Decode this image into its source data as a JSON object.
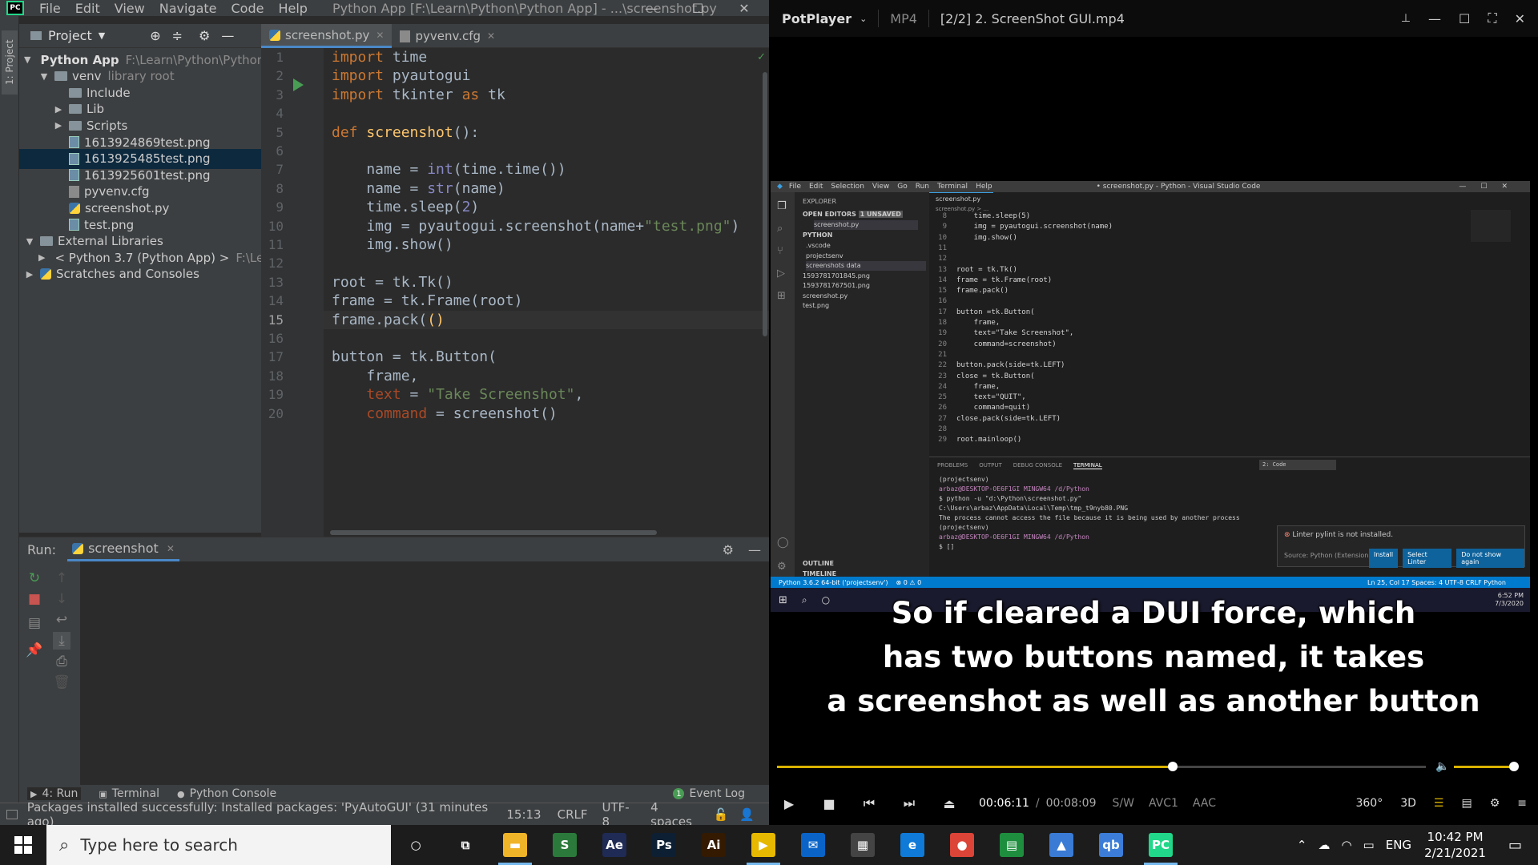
{
  "pycharm": {
    "menu": [
      "File",
      "Edit",
      "View",
      "Navigate",
      "Code",
      "Help"
    ],
    "title": "Python App [F:\\Learn\\Python\\Python App] - ...\\screenshot.py",
    "project_header": "Project",
    "left_tab": "1: Project",
    "tree": [
      {
        "label": "Python App",
        "hint": "F:\\Learn\\Python\\Python A",
        "indent": 0,
        "kind": "folder",
        "tw": "▼",
        "bold": true
      },
      {
        "label": "venv",
        "hint": "library root",
        "indent": 1,
        "kind": "folder",
        "tw": "▼"
      },
      {
        "label": "Include",
        "hint": "",
        "indent": 2,
        "kind": "folder",
        "tw": ""
      },
      {
        "label": "Lib",
        "hint": "",
        "indent": 2,
        "kind": "folder",
        "tw": "▶"
      },
      {
        "label": "Scripts",
        "hint": "",
        "indent": 2,
        "kind": "folder",
        "tw": "▶"
      },
      {
        "label": "1613924869test.png",
        "hint": "",
        "indent": 2,
        "kind": "png",
        "tw": ""
      },
      {
        "label": "1613925485test.png",
        "hint": "",
        "indent": 2,
        "kind": "png",
        "tw": "",
        "selected": true
      },
      {
        "label": "1613925601test.png",
        "hint": "",
        "indent": 2,
        "kind": "png",
        "tw": ""
      },
      {
        "label": "pyvenv.cfg",
        "hint": "",
        "indent": 2,
        "kind": "cfg",
        "tw": ""
      },
      {
        "label": "screenshot.py",
        "hint": "",
        "indent": 2,
        "kind": "py",
        "tw": ""
      },
      {
        "label": "test.png",
        "hint": "",
        "indent": 2,
        "kind": "png",
        "tw": ""
      },
      {
        "label": "External Libraries",
        "hint": "",
        "indent": 0,
        "kind": "lib",
        "tw": "▼"
      },
      {
        "label": "< Python 3.7 (Python App) >",
        "hint": "F:\\Le",
        "indent": 1,
        "kind": "py",
        "tw": "▶"
      },
      {
        "label": "Scratches and Consoles",
        "hint": "",
        "indent": 0,
        "kind": "scratch",
        "tw": "▶"
      }
    ],
    "tabs": [
      {
        "label": "screenshot.py",
        "active": true
      },
      {
        "label": "pyvenv.cfg",
        "active": false
      }
    ],
    "line_numbers": [
      "1",
      "2",
      "3",
      "4",
      "5",
      "6",
      "7",
      "8",
      "9",
      "10",
      "11",
      "12",
      "13",
      "14",
      "15",
      "16",
      "17",
      "18",
      "19",
      "20"
    ],
    "current_line": 15,
    "code": [
      [
        [
          "kw",
          "import"
        ],
        [
          "t",
          " time"
        ]
      ],
      [
        [
          "kw",
          "import"
        ],
        [
          "t",
          " pyautogui"
        ]
      ],
      [
        [
          "kw",
          "import"
        ],
        [
          "t",
          " tkinter "
        ],
        [
          "kw",
          "as"
        ],
        [
          "t",
          " tk"
        ]
      ],
      [],
      [
        [
          "kw",
          "def"
        ],
        [
          "t",
          " "
        ],
        [
          "fn",
          "screenshot"
        ],
        [
          "t",
          "():"
        ]
      ],
      [],
      [
        [
          "t",
          "    name = "
        ],
        [
          "bi",
          "int"
        ],
        [
          "t",
          "(time.time())"
        ]
      ],
      [
        [
          "t",
          "    name = "
        ],
        [
          "bi",
          "str"
        ],
        [
          "t",
          "(name)"
        ]
      ],
      [
        [
          "t",
          "    time.sleep("
        ],
        [
          "bi",
          "2"
        ],
        [
          "t",
          ")"
        ]
      ],
      [
        [
          "t",
          "    img = pyautogui.screenshot(name+"
        ],
        [
          "st",
          "\"test.png\""
        ],
        [
          "t",
          ")"
        ]
      ],
      [
        [
          "t",
          "    img.show()"
        ]
      ],
      [],
      [
        [
          "t",
          "root = tk.Tk()"
        ]
      ],
      [
        [
          "t",
          "frame = tk.Frame(root)"
        ]
      ],
      [
        [
          "t",
          "frame.pack("
        ],
        [
          "fn",
          "()"
        ]
      ],
      [],
      [
        [
          "t",
          "button = tk.Button("
        ]
      ],
      [
        [
          "t",
          "    frame,"
        ]
      ],
      [
        [
          "t",
          "    "
        ],
        [
          "pm",
          "text"
        ],
        [
          "t",
          " = "
        ],
        [
          "st",
          "\"Take Screenshot\""
        ],
        [
          "t",
          ","
        ]
      ],
      [
        [
          "t",
          "    "
        ],
        [
          "pm",
          "command"
        ],
        [
          "t",
          " = screenshot()"
        ]
      ]
    ],
    "run_label": "Run:",
    "run_tab": "screenshot",
    "bottom_tabs": [
      "4: Run",
      "Terminal",
      "Python Console"
    ],
    "event_log": "Event Log",
    "status_msg": "Packages installed successfully: Installed packages: 'PyAutoGUI' (31 minutes ago)",
    "status_pos": "15:13",
    "status_eol": "CRLF",
    "status_enc": "UTF-8",
    "status_indent": "4 spaces"
  },
  "potplayer": {
    "brand": "PotPlayer",
    "format": "MP4",
    "file": "[2/2] 2. ScreenShot GUI.mp4",
    "subtitle_lines": [
      "So if cleared a DUI force, which",
      "has two buttons named, it takes",
      "a screenshot as well as another button"
    ],
    "time_current": "00:06:11",
    "time_total": "00:08:09",
    "badges": [
      "S/W",
      "AVC1",
      "AAC"
    ],
    "progress_fraction": 0.61,
    "video": {
      "title": "• screenshot.py - Python - Visual Studio Code",
      "menu": [
        "File",
        "Edit",
        "Selection",
        "View",
        "Go",
        "Run",
        "Terminal",
        "Help"
      ],
      "explorer": "EXPLORER",
      "open_editors": "OPEN EDITORS",
      "unsaved": "1 UNSAVED",
      "open_file": "screenshot.py",
      "python_folder": "PYTHON",
      "files": [
        ".vscode",
        "projectsenv",
        "screenshots data",
        "1593781701845.png",
        "1593781767501.png",
        "screenshot.py",
        "test.png"
      ],
      "outline": "OUTLINE",
      "timeline": "TIMELINE",
      "tab": "screenshot.py",
      "breadcrumb": "screenshot.py > ...",
      "code_numbers": [
        "8",
        "9",
        "10",
        "11",
        "12",
        "13",
        "14",
        "15",
        "16",
        "17",
        "18",
        "19",
        "20",
        "21",
        "22",
        "23",
        "24",
        "25",
        "26",
        "27",
        "28",
        "29"
      ],
      "code_lines": [
        "    time.sleep(5)",
        "    img = pyautogui.screenshot(name)",
        "    img.show()",
        "",
        "",
        "root = tk.Tk()",
        "frame = tk.Frame(root)",
        "frame.pack()",
        "",
        "button =tk.Button(",
        "    frame,",
        "    text=\"Take Screenshot\",",
        "    command=screenshot)",
        "",
        "button.pack(side=tk.LEFT)",
        "close = tk.Button(",
        "    frame,",
        "    text=\"QUIT\",",
        "    command=quit)",
        "close.pack(side=tk.LEFT)",
        "",
        "root.mainloop()"
      ],
      "term_tabs": [
        "PROBLEMS",
        "OUTPUT",
        "DEBUG CONSOLE",
        "TERMINAL"
      ],
      "term_select": "2: Code",
      "term_lines": [
        "(projectsenv)",
        "arbaz@DESKTOP-OE6F1GI MINGW64 /d/Python",
        "$ python -u \"d:\\Python\\screenshot.py\"",
        "C:\\Users\\arbaz\\AppData\\Local\\Temp\\tmp_t9nyb80.PNG",
        "The process cannot access the file because it is being used by another process",
        "(projectsenv)",
        "arbaz@DESKTOP-OE6F1GI MINGW64 /d/Python",
        "$ []"
      ],
      "toast_msg": "Linter pylint is not installed.",
      "toast_source": "Source: Python (Extension)",
      "toast_buttons": [
        "Install",
        "Select Linter",
        "Do not show again"
      ],
      "status_left": "Python 3.6.2 64-bit ('projectsenv')",
      "status_err": "⊗ 0 ⚠ 0",
      "status_right": "Ln 25, Col 17   Spaces: 4   UTF-8   CRLF   Python",
      "tray_time": "6:52 PM",
      "tray_date": "7/3/2020"
    }
  },
  "taskbar": {
    "search_placeholder": "Type here to search",
    "apps": [
      {
        "name": "cortana",
        "label": "○",
        "bg": "transparent"
      },
      {
        "name": "task-view",
        "label": "⧉",
        "bg": "transparent"
      },
      {
        "name": "file-explorer",
        "label": "▬",
        "bg": "#f0b429"
      },
      {
        "name": "sublime",
        "label": "S",
        "bg": "#2b7a3b"
      },
      {
        "name": "after-effects",
        "label": "Ae",
        "bg": "#1f2a55"
      },
      {
        "name": "photoshop",
        "label": "Ps",
        "bg": "#0d1f33"
      },
      {
        "name": "illustrator",
        "label": "Ai",
        "bg": "#331a00"
      },
      {
        "name": "potplayer",
        "label": "▶",
        "bg": "#e6b800"
      },
      {
        "name": "mail",
        "label": "✉",
        "bg": "#0a64c8"
      },
      {
        "name": "store",
        "label": "▦",
        "bg": "#444"
      },
      {
        "name": "edge",
        "label": "e",
        "bg": "#0f7ad8"
      },
      {
        "name": "chrome",
        "label": "●",
        "bg": "#db4437"
      },
      {
        "name": "sheets",
        "label": "▤",
        "bg": "#1e8e3e"
      },
      {
        "name": "photos",
        "label": "▲",
        "bg": "#3a7bd5"
      },
      {
        "name": "qbittorrent",
        "label": "qb",
        "bg": "#3b7dd8"
      },
      {
        "name": "pycharm",
        "label": "PC",
        "bg": "#21d789"
      }
    ],
    "lang": "ENG",
    "time": "10:42 PM",
    "date": "2/21/2021"
  }
}
